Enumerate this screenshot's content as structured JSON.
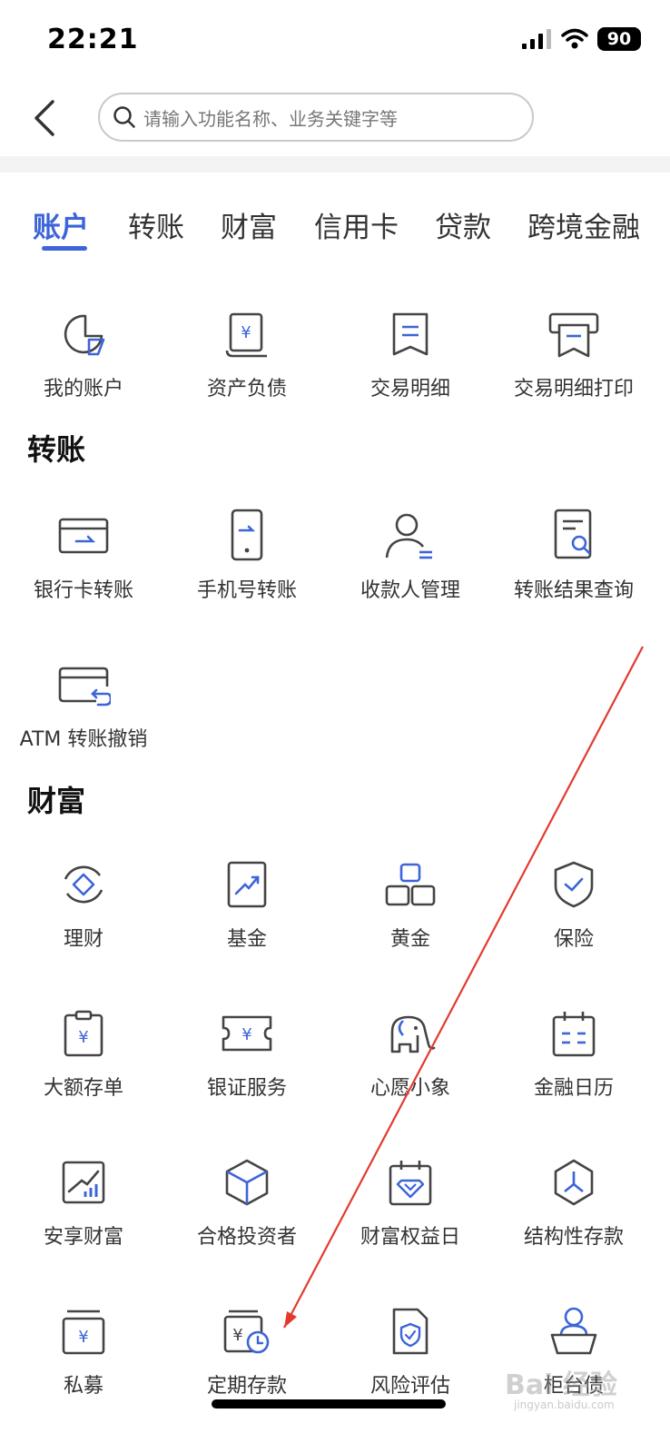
{
  "status_bar": {
    "time": "22:21",
    "battery": "90"
  },
  "search": {
    "placeholder": "请输入功能名称、业务关键字等"
  },
  "tabs": [
    {
      "label": "账户",
      "active": true
    },
    {
      "label": "转账",
      "active": false
    },
    {
      "label": "财富",
      "active": false
    },
    {
      "label": "信用卡",
      "active": false
    },
    {
      "label": "贷款",
      "active": false
    },
    {
      "label": "跨境金融",
      "active": false
    }
  ],
  "accent_color": "#3d64d8",
  "sections": {
    "account": {
      "items": [
        {
          "label": "我的账户",
          "icon": "pie-account-icon"
        },
        {
          "label": "资产负债",
          "icon": "yuan-scroll-icon"
        },
        {
          "label": "交易明细",
          "icon": "receipt-icon"
        },
        {
          "label": "交易明细打印",
          "icon": "printer-icon"
        }
      ]
    },
    "transfer": {
      "title": "转账",
      "items": [
        {
          "label": "银行卡转账",
          "icon": "card-transfer-icon"
        },
        {
          "label": "手机号转账",
          "icon": "phone-transfer-icon"
        },
        {
          "label": "收款人管理",
          "icon": "payee-icon"
        },
        {
          "label": "转账结果查询",
          "icon": "document-search-icon"
        },
        {
          "label": "ATM 转账撤销",
          "icon": "card-undo-icon"
        }
      ]
    },
    "wealth": {
      "title": "财富",
      "items": [
        {
          "label": "理财",
          "icon": "cycle-diamond-icon"
        },
        {
          "label": "基金",
          "icon": "trend-box-icon"
        },
        {
          "label": "黄金",
          "icon": "gold-bars-icon"
        },
        {
          "label": "保险",
          "icon": "shield-check-icon"
        },
        {
          "label": "大额存单",
          "icon": "clipboard-yuan-icon"
        },
        {
          "label": "银证服务",
          "icon": "ticket-yuan-icon"
        },
        {
          "label": "心愿小象",
          "icon": "elephant-icon"
        },
        {
          "label": "金融日历",
          "icon": "calendar-icon"
        },
        {
          "label": "安享财富",
          "icon": "growth-chart-icon"
        },
        {
          "label": "合格投资者",
          "icon": "cube-icon"
        },
        {
          "label": "财富权益日",
          "icon": "calendar-diamond-icon"
        },
        {
          "label": "结构性存款",
          "icon": "hexagon-icon"
        },
        {
          "label": "私募",
          "icon": "yuan-tray-icon"
        },
        {
          "label": "定期存款",
          "icon": "yuan-clock-icon"
        },
        {
          "label": "风险评估",
          "icon": "document-shield-icon"
        },
        {
          "label": "柜台债",
          "icon": "counter-person-icon"
        }
      ]
    }
  },
  "watermark": {
    "text": "Bai 经验",
    "sub": "jingyan.baidu.com"
  }
}
